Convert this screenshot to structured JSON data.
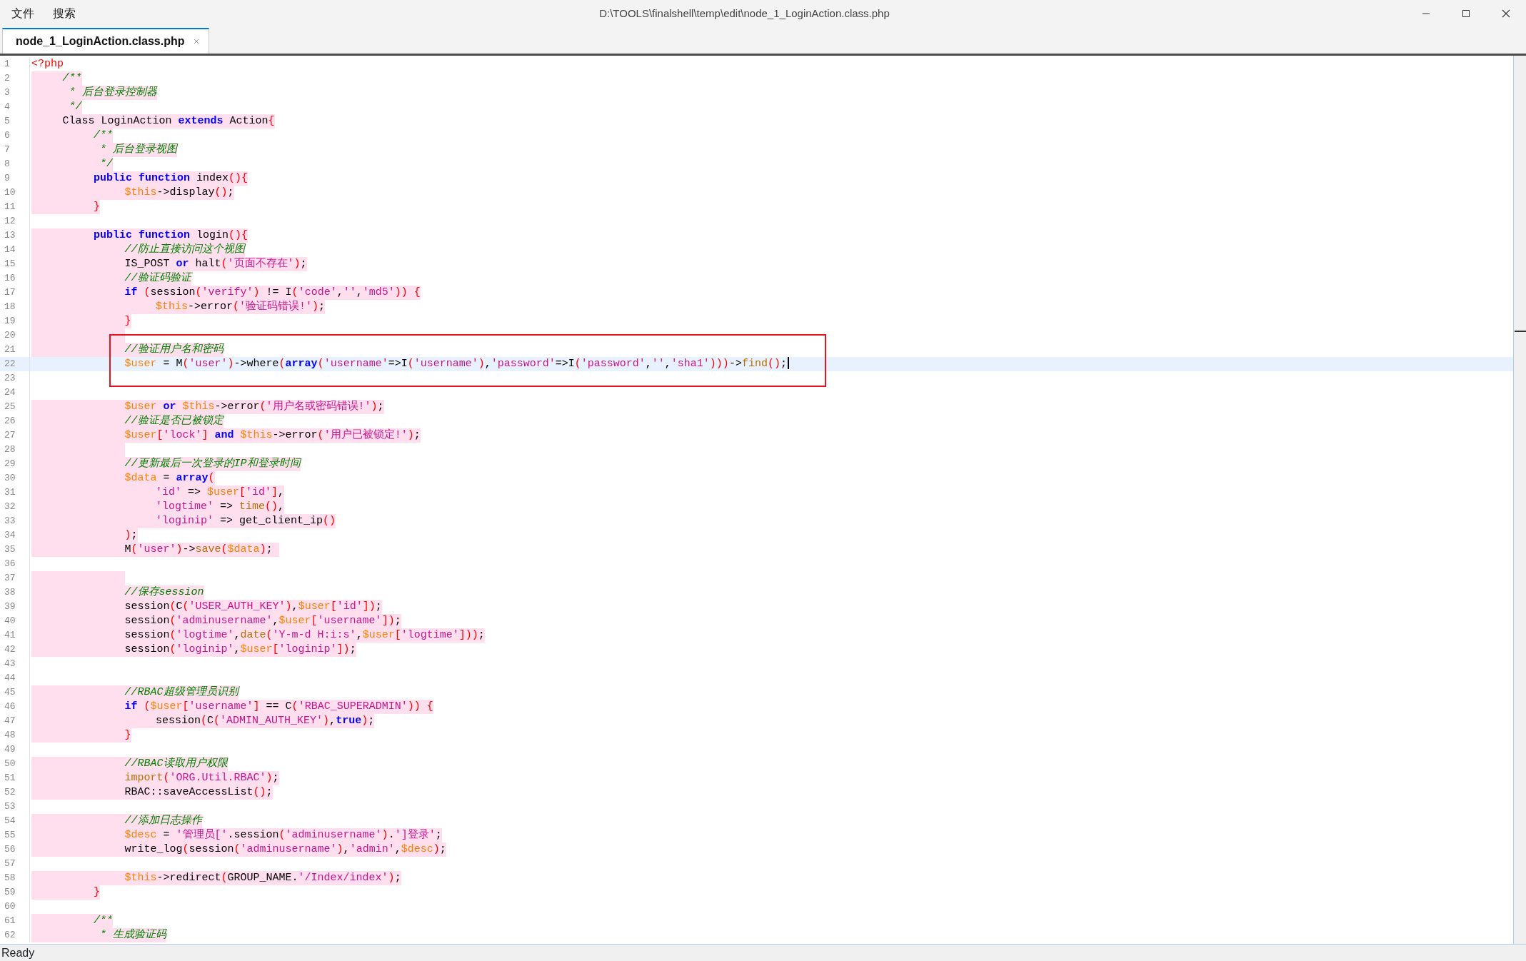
{
  "window": {
    "title": "D:\\TOOLS\\finalshell\\temp\\edit\\node_1_LoginAction.class.php"
  },
  "menu": [
    {
      "label": "文件"
    },
    {
      "label": "搜索"
    }
  ],
  "tabs": [
    {
      "label": "node_1_LoginAction.class.php",
      "selected": true
    }
  ],
  "lines": [
    {
      "number": "1",
      "highlighted": false,
      "current": false,
      "boxed": false,
      "segments": [
        {
          "kind": "tag",
          "text": "<?php"
        }
      ]
    },
    {
      "number": "2",
      "highlighted": true,
      "current": false,
      "boxed": false,
      "segments": [
        {
          "kind": "comment",
          "text": "\t/**"
        }
      ]
    },
    {
      "number": "3",
      "highlighted": true,
      "current": false,
      "boxed": false,
      "segments": [
        {
          "kind": "comment",
          "text": "\t * 后台登录控制器"
        }
      ]
    },
    {
      "number": "4",
      "highlighted": true,
      "current": false,
      "boxed": false,
      "segments": [
        {
          "kind": "comment",
          "text": "\t */"
        }
      ]
    },
    {
      "number": "5",
      "highlighted": true,
      "current": false,
      "boxed": false,
      "segments": [
        {
          "kind": "plain",
          "text": "\tClass LoginAction "
        },
        {
          "kind": "keyword",
          "text": "extends"
        },
        {
          "kind": "plain",
          "text": " Action"
        },
        {
          "kind": "bracket",
          "text": "{"
        }
      ]
    },
    {
      "number": "6",
      "highlighted": true,
      "current": false,
      "boxed": false,
      "segments": [
        {
          "kind": "comment",
          "text": "\t\t/**"
        }
      ]
    },
    {
      "number": "7",
      "highlighted": true,
      "current": false,
      "boxed": false,
      "segments": [
        {
          "kind": "comment",
          "text": "\t\t * 后台登录视图"
        }
      ]
    },
    {
      "number": "8",
      "highlighted": true,
      "current": false,
      "boxed": false,
      "segments": [
        {
          "kind": "comment",
          "text": "\t\t */"
        }
      ]
    },
    {
      "number": "9",
      "highlighted": true,
      "current": false,
      "boxed": false,
      "segments": [
        {
          "kind": "keyword",
          "text": "\t\tpublic function"
        },
        {
          "kind": "plain",
          "text": " index"
        },
        {
          "kind": "bracket",
          "text": "(){"
        }
      ]
    },
    {
      "number": "10",
      "highlighted": true,
      "current": false,
      "boxed": false,
      "segments": [
        {
          "kind": "variable",
          "text": "\t\t\t$this"
        },
        {
          "kind": "plain",
          "text": "->display"
        },
        {
          "kind": "bracket",
          "text": "()"
        },
        {
          "kind": "plain",
          "text": ";"
        }
      ]
    },
    {
      "number": "11",
      "highlighted": true,
      "current": false,
      "boxed": false,
      "segments": [
        {
          "kind": "bracket",
          "text": "\t\t}"
        }
      ]
    },
    {
      "number": "12",
      "highlighted": false,
      "current": false,
      "boxed": false
    },
    {
      "number": "13",
      "highlighted": true,
      "current": false,
      "boxed": false,
      "segments": [
        {
          "kind": "keyword",
          "text": "\t\tpublic function"
        },
        {
          "kind": "plain",
          "text": " login"
        },
        {
          "kind": "bracket",
          "text": "(){"
        }
      ]
    },
    {
      "number": "14",
      "highlighted": true,
      "current": false,
      "boxed": false,
      "segments": [
        {
          "kind": "comment",
          "text": "\t\t\t//防止直接访问这个视图"
        }
      ]
    },
    {
      "number": "15",
      "highlighted": true,
      "current": false,
      "boxed": false,
      "segments": [
        {
          "kind": "plain",
          "text": "\t\t\tIS_POST "
        },
        {
          "kind": "keyword",
          "text": "or"
        },
        {
          "kind": "plain",
          "text": " halt"
        },
        {
          "kind": "bracket",
          "text": "("
        },
        {
          "kind": "string",
          "text": "'页面不存在'"
        },
        {
          "kind": "bracket",
          "text": ")"
        },
        {
          "kind": "plain",
          "text": ";"
        }
      ]
    },
    {
      "number": "16",
      "highlighted": true,
      "current": false,
      "boxed": false,
      "segments": [
        {
          "kind": "comment",
          "text": "\t\t\t//验证码验证"
        }
      ]
    },
    {
      "number": "17",
      "highlighted": true,
      "current": false,
      "boxed": false,
      "segments": [
        {
          "kind": "keyword",
          "text": "\t\t\tif"
        },
        {
          "kind": "bracket",
          "text": " ("
        },
        {
          "kind": "plain",
          "text": "session"
        },
        {
          "kind": "bracket",
          "text": "("
        },
        {
          "kind": "string",
          "text": "'verify'"
        },
        {
          "kind": "bracket",
          "text": ")"
        },
        {
          "kind": "plain",
          "text": " != I"
        },
        {
          "kind": "bracket",
          "text": "("
        },
        {
          "kind": "string",
          "text": "'code'"
        },
        {
          "kind": "plain",
          "text": ","
        },
        {
          "kind": "string",
          "text": "''"
        },
        {
          "kind": "plain",
          "text": ","
        },
        {
          "kind": "string",
          "text": "'md5'"
        },
        {
          "kind": "bracket",
          "text": ")) {"
        }
      ]
    },
    {
      "number": "18",
      "highlighted": true,
      "current": false,
      "boxed": false,
      "segments": [
        {
          "kind": "variable",
          "text": "\t\t\t\t$this"
        },
        {
          "kind": "plain",
          "text": "->error"
        },
        {
          "kind": "bracket",
          "text": "("
        },
        {
          "kind": "string",
          "text": "'验证码错误!'"
        },
        {
          "kind": "bracket",
          "text": ")"
        },
        {
          "kind": "plain",
          "text": ";"
        }
      ]
    },
    {
      "number": "19",
      "highlighted": true,
      "current": false,
      "boxed": false,
      "segments": [
        {
          "kind": "bracket",
          "text": "\t\t\t}"
        }
      ]
    },
    {
      "number": "20",
      "highlighted": true,
      "current": false,
      "boxed": false
    },
    {
      "number": "21",
      "highlighted": true,
      "current": false,
      "boxed": true,
      "segments": [
        {
          "kind": "comment",
          "text": "\t\t\t//验证用户名和密码"
        }
      ]
    },
    {
      "number": "22",
      "highlighted": false,
      "current": true,
      "boxed": true,
      "segments": [
        {
          "kind": "variable",
          "text": "\t\t\t$user"
        },
        {
          "kind": "plain",
          "text": " = M"
        },
        {
          "kind": "bracket",
          "text": "("
        },
        {
          "kind": "string",
          "text": "'user'"
        },
        {
          "kind": "bracket",
          "text": ")"
        },
        {
          "kind": "plain",
          "text": "->where"
        },
        {
          "kind": "bracket",
          "text": "("
        },
        {
          "kind": "keyword",
          "text": "array"
        },
        {
          "kind": "bracket",
          "text": "("
        },
        {
          "kind": "string",
          "text": "'username'"
        },
        {
          "kind": "plain",
          "text": "=>I"
        },
        {
          "kind": "bracket",
          "text": "("
        },
        {
          "kind": "string",
          "text": "'username'"
        },
        {
          "kind": "bracket",
          "text": ")"
        },
        {
          "kind": "plain",
          "text": ","
        },
        {
          "kind": "string",
          "text": "'password'"
        },
        {
          "kind": "plain",
          "text": "=>I"
        },
        {
          "kind": "bracket",
          "text": "("
        },
        {
          "kind": "string",
          "text": "'password'"
        },
        {
          "kind": "plain",
          "text": ","
        },
        {
          "kind": "string",
          "text": "''"
        },
        {
          "kind": "plain",
          "text": ","
        },
        {
          "kind": "string",
          "text": "'sha1'"
        },
        {
          "kind": "bracket",
          "text": ")))"
        },
        {
          "kind": "plain",
          "text": "->"
        },
        {
          "kind": "function",
          "text": "find"
        },
        {
          "kind": "bracket",
          "text": "()"
        },
        {
          "kind": "plain",
          "text": ";"
        }
      ]
    },
    {
      "number": "23",
      "highlighted": false,
      "current": false,
      "boxed": true
    },
    {
      "number": "24",
      "highlighted": false,
      "current": false,
      "boxed": false
    },
    {
      "number": "25",
      "highlighted": true,
      "current": false,
      "boxed": false,
      "segments": [
        {
          "kind": "variable",
          "text": "\t\t\t$user"
        },
        {
          "kind": "keyword",
          "text": " or"
        },
        {
          "kind": "variable",
          "text": " $this"
        },
        {
          "kind": "plain",
          "text": "->error"
        },
        {
          "kind": "bracket",
          "text": "("
        },
        {
          "kind": "string",
          "text": "'用户名或密码错误!'"
        },
        {
          "kind": "bracket",
          "text": ")"
        },
        {
          "kind": "plain",
          "text": ";"
        }
      ]
    },
    {
      "number": "26",
      "highlighted": true,
      "current": false,
      "boxed": false,
      "segments": [
        {
          "kind": "comment",
          "text": "\t\t\t//验证是否已被锁定"
        }
      ]
    },
    {
      "number": "27",
      "highlighted": true,
      "current": false,
      "boxed": false,
      "segments": [
        {
          "kind": "variable",
          "text": "\t\t\t$user"
        },
        {
          "kind": "bracket",
          "text": "["
        },
        {
          "kind": "string",
          "text": "'lock'"
        },
        {
          "kind": "bracket",
          "text": "]"
        },
        {
          "kind": "keyword",
          "text": " and"
        },
        {
          "kind": "variable",
          "text": " $this"
        },
        {
          "kind": "plain",
          "text": "->error"
        },
        {
          "kind": "bracket",
          "text": "("
        },
        {
          "kind": "string",
          "text": "'用户已被锁定!'"
        },
        {
          "kind": "bracket",
          "text": ")"
        },
        {
          "kind": "plain",
          "text": ";"
        }
      ]
    },
    {
      "number": "28",
      "highlighted": true,
      "current": false,
      "boxed": false
    },
    {
      "number": "29",
      "highlighted": true,
      "current": false,
      "boxed": false,
      "segments": [
        {
          "kind": "comment",
          "text": "\t\t\t//更新最后一次登录的IP和登录时间"
        }
      ]
    },
    {
      "number": "30",
      "highlighted": true,
      "current": false,
      "boxed": false,
      "segments": [
        {
          "kind": "variable",
          "text": "\t\t\t$data"
        },
        {
          "kind": "plain",
          "text": " ="
        },
        {
          "kind": "keyword",
          "text": " array"
        },
        {
          "kind": "bracket",
          "text": "("
        }
      ]
    },
    {
      "number": "31",
      "highlighted": true,
      "current": false,
      "boxed": false,
      "segments": [
        {
          "kind": "string",
          "text": "\t\t\t\t'id'"
        },
        {
          "kind": "plain",
          "text": " =>"
        },
        {
          "kind": "variable",
          "text": " $user"
        },
        {
          "kind": "bracket",
          "text": "["
        },
        {
          "kind": "string",
          "text": "'id'"
        },
        {
          "kind": "bracket",
          "text": "]"
        },
        {
          "kind": "plain",
          "text": ","
        }
      ]
    },
    {
      "number": "32",
      "highlighted": true,
      "current": false,
      "boxed": false,
      "segments": [
        {
          "kind": "string",
          "text": "\t\t\t\t'logtime'"
        },
        {
          "kind": "plain",
          "text": " =>"
        },
        {
          "kind": "function",
          "text": " time"
        },
        {
          "kind": "bracket",
          "text": "()"
        },
        {
          "kind": "plain",
          "text": ","
        }
      ]
    },
    {
      "number": "33",
      "highlighted": true,
      "current": false,
      "boxed": false,
      "segments": [
        {
          "kind": "string",
          "text": "\t\t\t\t'loginip'"
        },
        {
          "kind": "plain",
          "text": " => get_client_ip"
        },
        {
          "kind": "bracket",
          "text": "()"
        }
      ]
    },
    {
      "number": "34",
      "highlighted": true,
      "current": false,
      "boxed": false,
      "segments": [
        {
          "kind": "bracket",
          "text": "\t\t\t)"
        },
        {
          "kind": "plain",
          "text": ";"
        }
      ]
    },
    {
      "number": "35",
      "highlighted": true,
      "current": false,
      "boxed": false,
      "segments": [
        {
          "kind": "plain",
          "text": "\t\t\tM"
        },
        {
          "kind": "bracket",
          "text": "("
        },
        {
          "kind": "string",
          "text": "'user'"
        },
        {
          "kind": "bracket",
          "text": ")"
        },
        {
          "kind": "plain",
          "text": "->"
        },
        {
          "kind": "function",
          "text": "save"
        },
        {
          "kind": "bracket",
          "text": "("
        },
        {
          "kind": "variable",
          "text": "$data"
        },
        {
          "kind": "bracket",
          "text": ")"
        },
        {
          "kind": "plain",
          "text": "; "
        }
      ]
    },
    {
      "number": "36",
      "highlighted": false,
      "current": false,
      "boxed": false
    },
    {
      "number": "37",
      "highlighted": true,
      "current": false,
      "boxed": false
    },
    {
      "number": "38",
      "highlighted": true,
      "current": false,
      "boxed": false,
      "segments": [
        {
          "kind": "comment",
          "text": "\t\t\t//保存session"
        }
      ]
    },
    {
      "number": "39",
      "highlighted": true,
      "current": false,
      "boxed": false,
      "segments": [
        {
          "kind": "plain",
          "text": "\t\t\tsession"
        },
        {
          "kind": "bracket",
          "text": "("
        },
        {
          "kind": "plain",
          "text": "C"
        },
        {
          "kind": "bracket",
          "text": "("
        },
        {
          "kind": "string",
          "text": "'USER_AUTH_KEY'"
        },
        {
          "kind": "bracket",
          "text": ")"
        },
        {
          "kind": "plain",
          "text": ","
        },
        {
          "kind": "variable",
          "text": "$user"
        },
        {
          "kind": "bracket",
          "text": "["
        },
        {
          "kind": "string",
          "text": "'id'"
        },
        {
          "kind": "bracket",
          "text": "])"
        },
        {
          "kind": "plain",
          "text": ";"
        }
      ]
    },
    {
      "number": "40",
      "highlighted": true,
      "current": false,
      "boxed": false,
      "segments": [
        {
          "kind": "plain",
          "text": "\t\t\tsession"
        },
        {
          "kind": "bracket",
          "text": "("
        },
        {
          "kind": "string",
          "text": "'adminusername'"
        },
        {
          "kind": "plain",
          "text": ","
        },
        {
          "kind": "variable",
          "text": "$user"
        },
        {
          "kind": "bracket",
          "text": "["
        },
        {
          "kind": "string",
          "text": "'username'"
        },
        {
          "kind": "bracket",
          "text": "])"
        },
        {
          "kind": "plain",
          "text": ";"
        }
      ]
    },
    {
      "number": "41",
      "highlighted": true,
      "current": false,
      "boxed": false,
      "segments": [
        {
          "kind": "plain",
          "text": "\t\t\tsession"
        },
        {
          "kind": "bracket",
          "text": "("
        },
        {
          "kind": "string",
          "text": "'logtime'"
        },
        {
          "kind": "plain",
          "text": ","
        },
        {
          "kind": "function",
          "text": "date"
        },
        {
          "kind": "bracket",
          "text": "("
        },
        {
          "kind": "string",
          "text": "'Y-m-d H:i:s'"
        },
        {
          "kind": "plain",
          "text": ","
        },
        {
          "kind": "variable",
          "text": "$user"
        },
        {
          "kind": "bracket",
          "text": "["
        },
        {
          "kind": "string",
          "text": "'logtime'"
        },
        {
          "kind": "bracket",
          "text": "]))"
        },
        {
          "kind": "plain",
          "text": ";"
        }
      ]
    },
    {
      "number": "42",
      "highlighted": true,
      "current": false,
      "boxed": false,
      "segments": [
        {
          "kind": "plain",
          "text": "\t\t\tsession"
        },
        {
          "kind": "bracket",
          "text": "("
        },
        {
          "kind": "string",
          "text": "'loginip'"
        },
        {
          "kind": "plain",
          "text": ","
        },
        {
          "kind": "variable",
          "text": "$user"
        },
        {
          "kind": "bracket",
          "text": "["
        },
        {
          "kind": "string",
          "text": "'loginip'"
        },
        {
          "kind": "bracket",
          "text": "])"
        },
        {
          "kind": "plain",
          "text": ";"
        }
      ]
    },
    {
      "number": "43",
      "highlighted": false,
      "current": false,
      "boxed": false
    },
    {
      "number": "44",
      "highlighted": false,
      "current": false,
      "boxed": false
    },
    {
      "number": "45",
      "highlighted": true,
      "current": false,
      "boxed": false,
      "segments": [
        {
          "kind": "comment",
          "text": "\t\t\t//RBAC超级管理员识别"
        }
      ]
    },
    {
      "number": "46",
      "highlighted": true,
      "current": false,
      "boxed": false,
      "segments": [
        {
          "kind": "keyword",
          "text": "\t\t\tif"
        },
        {
          "kind": "bracket",
          "text": " ("
        },
        {
          "kind": "variable",
          "text": "$user"
        },
        {
          "kind": "bracket",
          "text": "["
        },
        {
          "kind": "string",
          "text": "'username'"
        },
        {
          "kind": "bracket",
          "text": "]"
        },
        {
          "kind": "plain",
          "text": " == C"
        },
        {
          "kind": "bracket",
          "text": "("
        },
        {
          "kind": "string",
          "text": "'RBAC_SUPERADMIN'"
        },
        {
          "kind": "bracket",
          "text": ")) {"
        }
      ]
    },
    {
      "number": "47",
      "highlighted": true,
      "current": false,
      "boxed": false,
      "segments": [
        {
          "kind": "plain",
          "text": "\t\t\t\tsession"
        },
        {
          "kind": "bracket",
          "text": "("
        },
        {
          "kind": "plain",
          "text": "C"
        },
        {
          "kind": "bracket",
          "text": "("
        },
        {
          "kind": "string",
          "text": "'ADMIN_AUTH_KEY'"
        },
        {
          "kind": "bracket",
          "text": ")"
        },
        {
          "kind": "plain",
          "text": ","
        },
        {
          "kind": "keyword",
          "text": "true"
        },
        {
          "kind": "bracket",
          "text": ")"
        },
        {
          "kind": "plain",
          "text": ";"
        }
      ]
    },
    {
      "number": "48",
      "highlighted": true,
      "current": false,
      "boxed": false,
      "segments": [
        {
          "kind": "bracket",
          "text": "\t\t\t}"
        }
      ]
    },
    {
      "number": "49",
      "highlighted": false,
      "current": false,
      "boxed": false
    },
    {
      "number": "50",
      "highlighted": true,
      "current": false,
      "boxed": false,
      "segments": [
        {
          "kind": "comment",
          "text": "\t\t\t//RBAC读取用户权限"
        }
      ]
    },
    {
      "number": "51",
      "highlighted": true,
      "current": false,
      "boxed": false,
      "segments": [
        {
          "kind": "function",
          "text": "\t\t\timport"
        },
        {
          "kind": "bracket",
          "text": "("
        },
        {
          "kind": "string",
          "text": "'ORG.Util.RBAC'"
        },
        {
          "kind": "bracket",
          "text": ")"
        },
        {
          "kind": "plain",
          "text": ";"
        }
      ]
    },
    {
      "number": "52",
      "highlighted": true,
      "current": false,
      "boxed": false,
      "segments": [
        {
          "kind": "plain",
          "text": "\t\t\tRBAC::saveAccessList"
        },
        {
          "kind": "bracket",
          "text": "()"
        },
        {
          "kind": "plain",
          "text": ";"
        }
      ]
    },
    {
      "number": "53",
      "highlighted": false,
      "current": false,
      "boxed": false
    },
    {
      "number": "54",
      "highlighted": true,
      "current": false,
      "boxed": false,
      "segments": [
        {
          "kind": "comment",
          "text": "\t\t\t//添加日志操作"
        }
      ]
    },
    {
      "number": "55",
      "highlighted": true,
      "current": false,
      "boxed": false,
      "segments": [
        {
          "kind": "variable",
          "text": "\t\t\t$desc"
        },
        {
          "kind": "plain",
          "text": " ="
        },
        {
          "kind": "string",
          "text": " '管理员['"
        },
        {
          "kind": "plain",
          "text": ".session"
        },
        {
          "kind": "bracket",
          "text": "("
        },
        {
          "kind": "string",
          "text": "'adminusername'"
        },
        {
          "kind": "bracket",
          "text": ")"
        },
        {
          "kind": "plain",
          "text": "."
        },
        {
          "kind": "string",
          "text": "']登录'"
        },
        {
          "kind": "plain",
          "text": ";"
        }
      ]
    },
    {
      "number": "56",
      "highlighted": true,
      "current": false,
      "boxed": false,
      "segments": [
        {
          "kind": "plain",
          "text": "\t\t\twrite_log"
        },
        {
          "kind": "bracket",
          "text": "("
        },
        {
          "kind": "plain",
          "text": "session"
        },
        {
          "kind": "bracket",
          "text": "("
        },
        {
          "kind": "string",
          "text": "'adminusername'"
        },
        {
          "kind": "bracket",
          "text": ")"
        },
        {
          "kind": "plain",
          "text": ","
        },
        {
          "kind": "string",
          "text": "'admin'"
        },
        {
          "kind": "plain",
          "text": ","
        },
        {
          "kind": "variable",
          "text": "$desc"
        },
        {
          "kind": "bracket",
          "text": ")"
        },
        {
          "kind": "plain",
          "text": ";"
        }
      ]
    },
    {
      "number": "57",
      "highlighted": false,
      "current": false,
      "boxed": false
    },
    {
      "number": "58",
      "highlighted": true,
      "current": false,
      "boxed": false,
      "segments": [
        {
          "kind": "variable",
          "text": "\t\t\t$this"
        },
        {
          "kind": "plain",
          "text": "->redirect"
        },
        {
          "kind": "bracket",
          "text": "("
        },
        {
          "kind": "plain",
          "text": "GROUP_NAME."
        },
        {
          "kind": "string",
          "text": "'/Index/index'"
        },
        {
          "kind": "bracket",
          "text": ")"
        },
        {
          "kind": "plain",
          "text": ";"
        }
      ]
    },
    {
      "number": "59",
      "highlighted": true,
      "current": false,
      "boxed": false,
      "segments": [
        {
          "kind": "bracket",
          "text": "\t\t}"
        }
      ]
    },
    {
      "number": "60",
      "highlighted": false,
      "current": false,
      "boxed": false
    },
    {
      "number": "61",
      "highlighted": true,
      "current": false,
      "boxed": false,
      "segments": [
        {
          "kind": "comment",
          "text": "\t\t/**"
        }
      ]
    },
    {
      "number": "62",
      "highlighted": true,
      "current": false,
      "boxed": false,
      "segments": [
        {
          "kind": "comment",
          "text": "\t\t * 生成验证码"
        }
      ]
    }
  ],
  "status_bar": {
    "text": "Ready"
  }
}
